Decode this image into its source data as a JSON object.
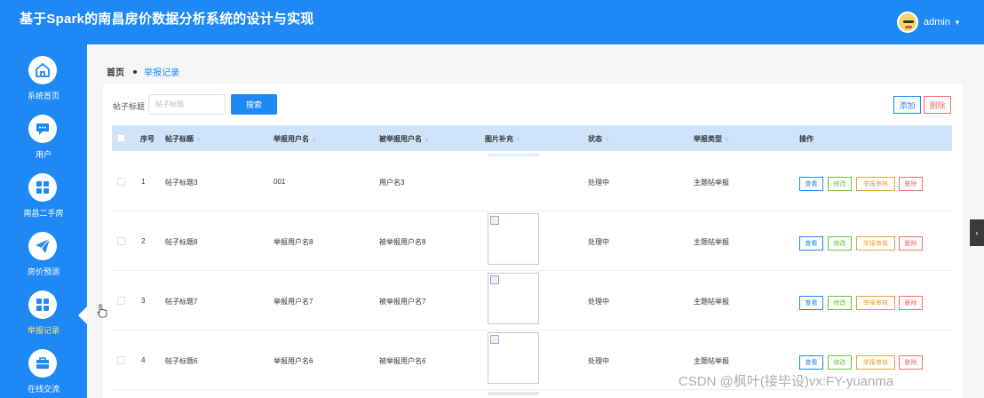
{
  "header": {
    "title": "基于Spark的南昌房价数据分析系统的设计与实现",
    "user": "admin"
  },
  "sidebar": {
    "items": [
      {
        "label": "系统首页",
        "icon": "home-icon"
      },
      {
        "label": "用户",
        "icon": "chat-icon"
      },
      {
        "label": "南昌二手房",
        "icon": "grid-icon"
      },
      {
        "label": "房价预测",
        "icon": "send-icon"
      },
      {
        "label": "举报记录",
        "icon": "grid-icon",
        "active": true
      },
      {
        "label": "在线交流",
        "icon": "briefcase-icon"
      }
    ]
  },
  "breadcrumb": {
    "home": "首页",
    "current": "举报记录"
  },
  "search": {
    "label": "帖子标题",
    "placeholder": "帖子标题",
    "button": "搜索"
  },
  "toolbar": {
    "add": "添加",
    "delete": "删除"
  },
  "table": {
    "columns": [
      "序号",
      "帖子标题",
      "举报用户名",
      "被举报用户名",
      "图片补充",
      "状态",
      "举报类型",
      "操作"
    ],
    "actions": [
      "查看",
      "修改",
      "举报审核",
      "删除"
    ],
    "rows": [
      {
        "index": "1",
        "title": "帖子标题3",
        "reporter": "001",
        "reported": "用户名3",
        "status": "处理中",
        "type": "主题帖举报"
      },
      {
        "index": "2",
        "title": "帖子标题8",
        "reporter": "举报用户名8",
        "reported": "被举报用户名8",
        "status": "处理中",
        "type": "主题帖举报"
      },
      {
        "index": "3",
        "title": "帖子标题7",
        "reporter": "举报用户名7",
        "reported": "被举报用户名7",
        "status": "处理中",
        "type": "主题帖举报"
      },
      {
        "index": "4",
        "title": "帖子标题6",
        "reporter": "举报用户名6",
        "reported": "被举报用户名6",
        "status": "处理中",
        "type": "主题帖举报"
      }
    ]
  },
  "watermark": "CSDN @枫叶(接毕设)vx:FY-yuanma",
  "colors": {
    "primary": "#1e88f5",
    "header_row": "#cfe4fb",
    "success": "#67c23a",
    "warning": "#e6a23c",
    "danger": "#f56c6c",
    "active_label": "#ffe36b"
  }
}
